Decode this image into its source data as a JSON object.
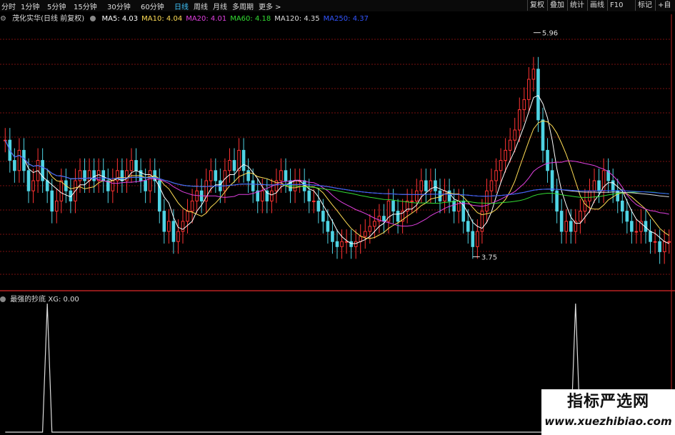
{
  "toolbar": {
    "tabs": [
      "分时",
      "1分钟",
      "5分钟",
      "15分钟",
      "30分钟",
      "60分钟",
      "日线",
      "周线",
      "月线",
      "多周期",
      "更多 >"
    ],
    "active_tab": "日线",
    "buttons": [
      "复权",
      "叠加",
      "统计",
      "画线",
      "F10",
      "标记",
      "+自"
    ]
  },
  "ma_bar": {
    "title": "茂化实华(日线 前复权)",
    "items": [
      {
        "label": "MA5: 4.03",
        "color": "#ffffff"
      },
      {
        "label": "MA10: 4.04",
        "color": "#ffdd55"
      },
      {
        "label": "MA20: 4.01",
        "color": "#e040e0"
      },
      {
        "label": "MA60: 4.18",
        "color": "#33dd33"
      },
      {
        "label": "MA120: 4.35",
        "color": "#dddddd"
      },
      {
        "label": "MA250: 4.37",
        "color": "#3355ff"
      }
    ]
  },
  "indicator": {
    "name": "最强的抄底",
    "value": "XG: 0.00"
  },
  "watermark": {
    "cn": "指标严选网",
    "url": "www.xuezhibiao.com"
  },
  "colors": {
    "up": "#ff3333",
    "down": "#4fd4e4",
    "grid": "#7a1010"
  },
  "chart_data": [
    {
      "type": "candlestick",
      "title": "",
      "ylim": [
        3.5,
        6.0
      ],
      "annotations": [
        {
          "label": "5.96",
          "value": 5.96,
          "index": 113
        },
        {
          "label": "3.75",
          "value": 3.75,
          "index": 100
        }
      ],
      "series": [
        {
          "name": "MA5",
          "color": "#ffffff",
          "last": 4.03
        },
        {
          "name": "MA10",
          "color": "#ffdd55",
          "last": 4.04
        },
        {
          "name": "MA20",
          "color": "#e040e0",
          "last": 4.01
        },
        {
          "name": "MA60",
          "color": "#33dd33",
          "last": 4.18
        },
        {
          "name": "MA120",
          "color": "#dddddd",
          "last": 4.35
        },
        {
          "name": "MA250",
          "color": "#3355ff",
          "last": 4.37
        }
      ],
      "closes": [
        4.9,
        4.7,
        4.6,
        4.8,
        4.6,
        4.4,
        4.5,
        4.7,
        4.5,
        4.4,
        4.2,
        4.3,
        4.5,
        4.4,
        4.3,
        4.5,
        4.6,
        4.5,
        4.6,
        4.5,
        4.6,
        4.5,
        4.4,
        4.5,
        4.6,
        4.5,
        4.6,
        4.7,
        4.6,
        4.5,
        4.4,
        4.6,
        4.5,
        4.2,
        4.0,
        4.1,
        3.9,
        4.0,
        4.1,
        4.2,
        4.3,
        4.4,
        4.3,
        4.5,
        4.6,
        4.5,
        4.4,
        4.6,
        4.7,
        4.6,
        4.8,
        4.6,
        4.5,
        4.4,
        4.3,
        4.4,
        4.3,
        4.4,
        4.5,
        4.6,
        4.5,
        4.4,
        4.5,
        4.5,
        4.4,
        4.3,
        4.3,
        4.2,
        4.1,
        4.0,
        3.9,
        3.85,
        3.9,
        3.9,
        3.85,
        3.9,
        3.95,
        4.0,
        4.05,
        4.1,
        4.15,
        4.1,
        4.3,
        4.2,
        4.1,
        4.2,
        4.3,
        4.3,
        4.4,
        4.5,
        4.4,
        4.5,
        4.4,
        4.3,
        4.4,
        4.3,
        4.2,
        4.3,
        4.1,
        4.0,
        3.85,
        4.0,
        4.2,
        4.4,
        4.5,
        4.6,
        4.7,
        4.8,
        4.9,
        5.0,
        5.2,
        5.3,
        5.5,
        5.6,
        5.1,
        4.8,
        4.6,
        4.4,
        4.2,
        4.0,
        4.1,
        4.0,
        4.1,
        4.2,
        4.3,
        4.4,
        4.5,
        4.4,
        4.6,
        4.5,
        4.4,
        4.3,
        4.2,
        4.1,
        4.0,
        4.0,
        4.1,
        4.0,
        3.9,
        3.9,
        3.8,
        3.9,
        3.9
      ]
    },
    {
      "type": "line",
      "name": "最强的抄底",
      "values": [
        0,
        0,
        0,
        0,
        0,
        0,
        0,
        0,
        0,
        0,
        0,
        0,
        0,
        0,
        0,
        0,
        0,
        0,
        0,
        0,
        0,
        0,
        0,
        0,
        0,
        0,
        0,
        0,
        0,
        0,
        0,
        0,
        0,
        0,
        0,
        0,
        0,
        0,
        0,
        0,
        0,
        0,
        0,
        0,
        0,
        0,
        0,
        0,
        0,
        0,
        0,
        0,
        0,
        0,
        0,
        0,
        0,
        0,
        0,
        0,
        0,
        0,
        0,
        0,
        0,
        0,
        0,
        0,
        0,
        0,
        0,
        0,
        0,
        0,
        0,
        0,
        0,
        0,
        0,
        0,
        0,
        0,
        0,
        0,
        0,
        0,
        0,
        0,
        0,
        0,
        0,
        0,
        0,
        0,
        0,
        0,
        0,
        0,
        0,
        0,
        0,
        0,
        0,
        0,
        0,
        0,
        0,
        0,
        0,
        0,
        0,
        0,
        0,
        0,
        0,
        0,
        0,
        0,
        0,
        0,
        0,
        0,
        0,
        0,
        0,
        0,
        0,
        0,
        0,
        0,
        0,
        0,
        0,
        0,
        0,
        0,
        0,
        0,
        0,
        0,
        0,
        0,
        0,
        0,
        0
      ],
      "spikes": [
        {
          "index": 9,
          "value": 1
        },
        {
          "index": 122,
          "value": 1
        }
      ],
      "current": 0
    }
  ]
}
